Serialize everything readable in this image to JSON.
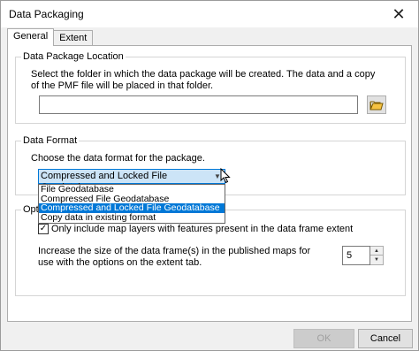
{
  "window": {
    "title": "Data Packaging",
    "close_glyph": "✕"
  },
  "tabs": [
    {
      "label": "General",
      "active": true
    },
    {
      "label": "Extent",
      "active": false
    }
  ],
  "location_group": {
    "legend": "Data Package Location",
    "description": "Select the folder in which the data package will be created. The data and a copy of the PMF file will be placed in that folder.",
    "path_value": "",
    "browse_icon": "open-folder-icon"
  },
  "format_group": {
    "legend": "Data Format",
    "description": "Choose the data format for the package.",
    "selected_value": "Compressed and Locked File Geodatabase",
    "options": [
      {
        "label": "File Geodatabase",
        "highlighted": false
      },
      {
        "label": "Compressed File Geodatabase",
        "highlighted": false
      },
      {
        "label": "Compressed and Locked File Geodatabase",
        "highlighted": true
      },
      {
        "label": "Copy data in existing format",
        "highlighted": false
      }
    ]
  },
  "options_group": {
    "legend": "Options",
    "checkbox_label": "Only include map layers with features present in the data frame extent",
    "checkbox_checked": true,
    "increase_label": "Increase the size of the data frame(s) in the published maps for use with the options on the extent tab.",
    "spin_value": "5"
  },
  "footer": {
    "ok_label": "OK",
    "ok_enabled": false,
    "cancel_label": "Cancel"
  }
}
